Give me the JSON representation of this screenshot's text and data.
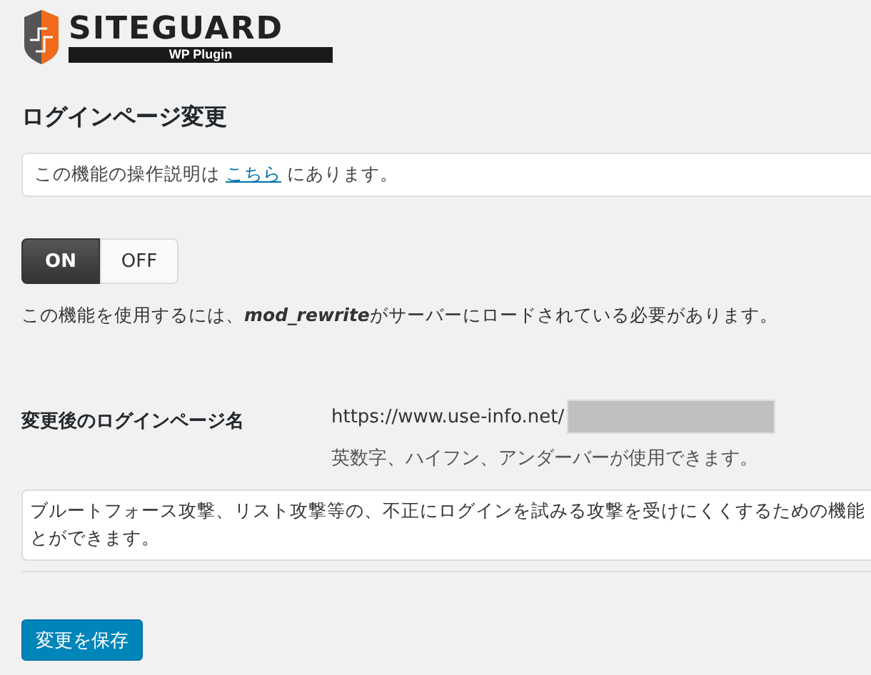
{
  "logo": {
    "name": "SITEGUARD",
    "sub": "WP Plugin"
  },
  "title": "ログインページ変更",
  "notice": {
    "before": "この機能の操作説明は ",
    "link": "こちら",
    "after": " にあります。"
  },
  "toggle": [
    {
      "label": "ON",
      "selected": true
    },
    {
      "label": "OFF",
      "selected": false
    }
  ],
  "requirement": "この機能を使用するには、**mod_rewrite**がサーバーにロードされている必要があります。",
  "setting": {
    "label": "変更後のログインページ名",
    "prefix": "https://www.use-info.net/",
    "hint": "英数字、ハイフン、アンダーバーが使用できます。"
  },
  "description": [
    "ブルートフォース攻撃、リスト攻撃等の、不正にログインを試みる攻撃を受けにくくするための機能",
    "とができます。"
  ],
  "save_button": "変更を保存"
}
